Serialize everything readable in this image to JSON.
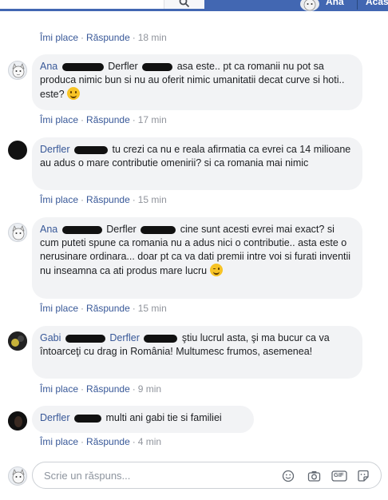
{
  "topbar": {
    "user_name": "Ana",
    "home_label": "Acas"
  },
  "comments": [
    {
      "actions": {
        "like": "Îmi place",
        "reply": "Răspunde",
        "time": "18 min"
      }
    },
    {
      "author": "Ana",
      "mention": "Derfler",
      "text": "asa este.. pt ca romanii nu pot sa produca nimic bun si nu au oferit nimic umanitatii decat curve si hoti.. este?",
      "emoji": "smile-emoji",
      "actions": {
        "like": "Îmi place",
        "reply": "Răspunde",
        "time": "17 min"
      }
    },
    {
      "author": "Derfler",
      "text": "tu crezi ca nu e reala afirmatia ca evrei ca 14 milioane au adus o mare contributie omenirii? si ca romania mai nimic",
      "actions": {
        "like": "Îmi place",
        "reply": "Răspunde",
        "time": "15 min"
      }
    },
    {
      "author": "Ana",
      "mention": "Derfler",
      "text": "cine sunt acesti evrei mai exact? si cum puteti spune ca romania nu a adus nici o contributie.. asta este o nerusinare ordinara... doar pt ca va dati premii intre voi si furati inventii nu inseamna ca ati produs mare lucru",
      "emoji": "wink-emoji",
      "actions": {
        "like": "Îmi place",
        "reply": "Răspunde",
        "time": "15 min"
      }
    },
    {
      "author": "Gabi",
      "mention": "Derfler",
      "text": "ştiu lucrul asta, şi ma bucur ca va întoarceţi cu drag in România! Multumesc frumos, asemenea!",
      "actions": {
        "like": "Îmi place",
        "reply": "Răspunde",
        "time": "9 min"
      }
    },
    {
      "author": "Derfler",
      "text": "multi ani gabi tie si familiei",
      "actions": {
        "like": "Îmi place",
        "reply": "Răspunde",
        "time": "4 min"
      }
    }
  ],
  "reply": {
    "placeholder": "Scrie un răspuns...",
    "gif_label": "GIF"
  }
}
